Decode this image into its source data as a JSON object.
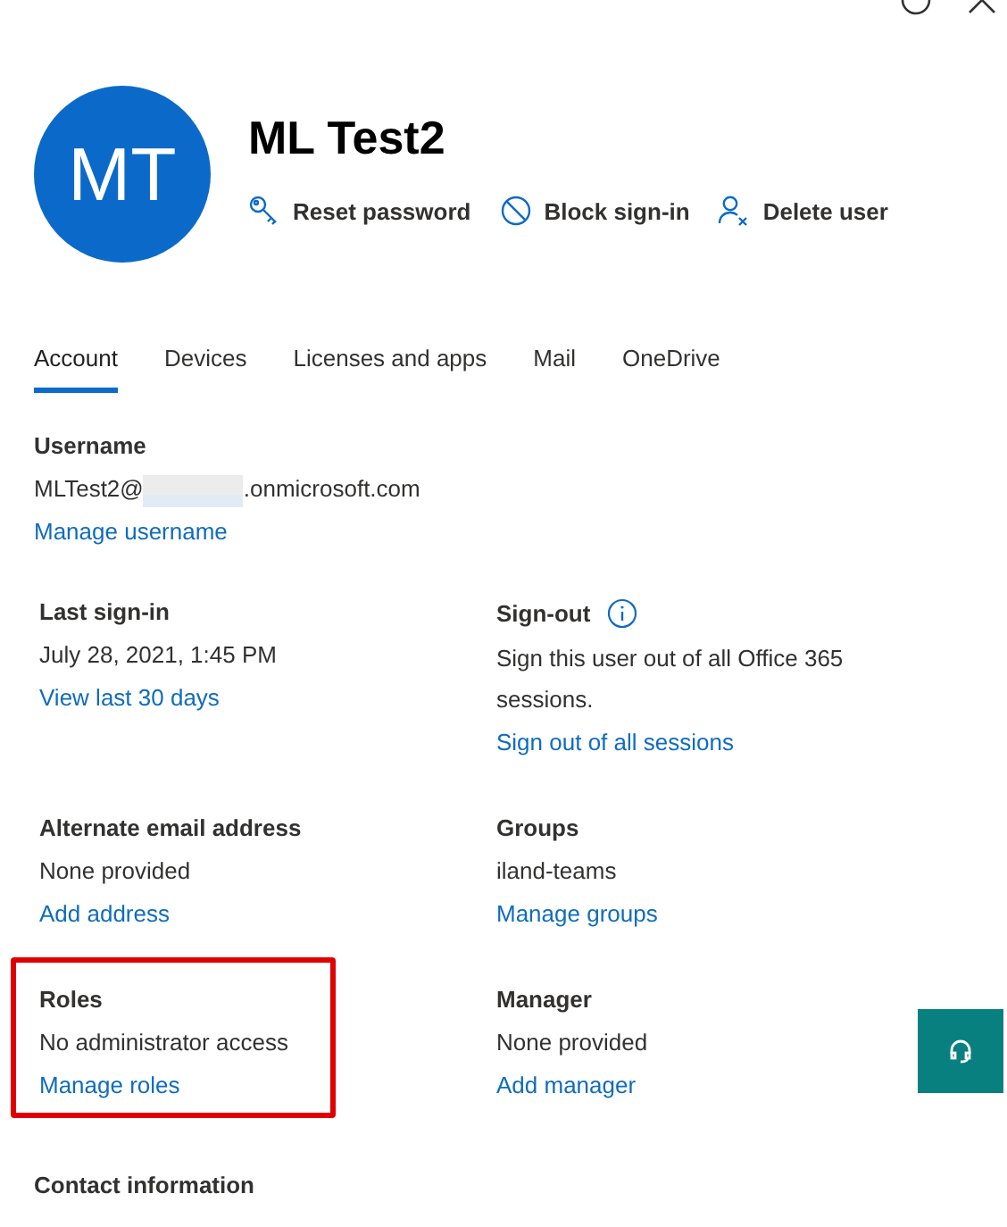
{
  "user": {
    "initials": "MT",
    "name": "ML Test2"
  },
  "actions": [
    {
      "kind": "key",
      "label": "Reset password"
    },
    {
      "kind": "block",
      "label": "Block sign-in"
    },
    {
      "kind": "delete",
      "label": "Delete user"
    }
  ],
  "tabs": [
    {
      "label": "Account",
      "selected": true
    },
    {
      "label": "Devices",
      "selected": false
    },
    {
      "label": "Licenses and apps",
      "selected": false
    },
    {
      "label": "Mail",
      "selected": false
    },
    {
      "label": "OneDrive",
      "selected": false
    }
  ],
  "username": {
    "title": "Username",
    "value_start": "MLTest2@",
    "value_end": ".onmicrosoft.com",
    "link": "Manage username"
  },
  "fields": [
    {
      "title": "Last sign-in",
      "value": "July 28, 2021, 1:45 PM",
      "link": "View last 30 days",
      "info": false,
      "highlighted": false
    },
    {
      "title": "Sign-out",
      "value": "Sign this user out of all Office 365 sessions.",
      "link": "Sign out of all sessions",
      "info": true,
      "highlighted": false
    },
    {
      "title": "Alternate email address",
      "value": "None provided",
      "link": "Add address",
      "info": false,
      "highlighted": false
    },
    {
      "title": "Groups",
      "value": "iland-teams",
      "link": "Manage groups",
      "info": false,
      "highlighted": false
    },
    {
      "title": "Roles",
      "value": "No administrator access",
      "link": "Manage roles",
      "info": false,
      "highlighted": true
    },
    {
      "title": "Manager",
      "value": "None provided",
      "link": "Add manager",
      "info": false,
      "highlighted": false
    }
  ],
  "footer_heading": "Contact information"
}
